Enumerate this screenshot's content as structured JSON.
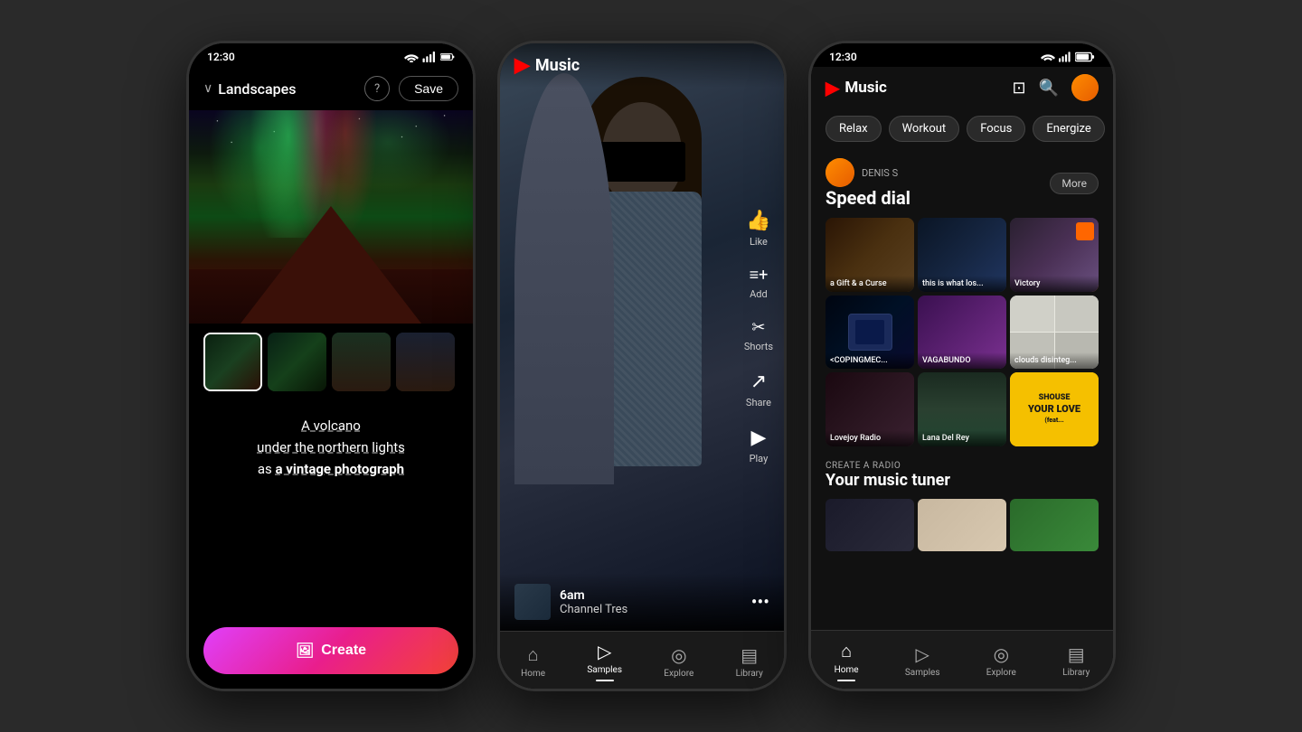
{
  "background": "#2a2a2a",
  "phone1": {
    "status_time": "12:30",
    "header": {
      "title": "Landscapes",
      "help_label": "?",
      "save_label": "Save"
    },
    "thumbnails": [
      {
        "id": "thumb1",
        "label": "aurora volcano",
        "selected": true
      },
      {
        "id": "thumb2",
        "label": "aurora 2",
        "selected": false
      },
      {
        "id": "thumb3",
        "label": "mountain",
        "selected": false
      },
      {
        "id": "thumb4",
        "label": "mountain 2",
        "selected": false
      }
    ],
    "prompt": {
      "line1": "A volcano",
      "line2": "under the northern lights",
      "line3_prefix": "as ",
      "line3_main": "a vintage photograph"
    },
    "create_btn": "Create",
    "create_icon": "🖼"
  },
  "phone2": {
    "status_time": "",
    "music_logo": "Music",
    "side_actions": [
      {
        "icon": "👍",
        "label": "Like"
      },
      {
        "icon": "☰+",
        "label": "Add"
      },
      {
        "icon": "✂",
        "label": "Shorts"
      },
      {
        "icon": "↗",
        "label": "Share"
      },
      {
        "icon": "▶",
        "label": "Play"
      }
    ],
    "song": {
      "time": "6am",
      "name": "Channel Tres"
    },
    "nav_items": [
      {
        "icon": "🏠",
        "label": "Home",
        "active": false
      },
      {
        "icon": "▶",
        "label": "Samples",
        "active": true
      },
      {
        "icon": "🧭",
        "label": "Explore",
        "active": false
      },
      {
        "icon": "📚",
        "label": "Library",
        "active": false
      }
    ]
  },
  "phone3": {
    "status_time": "12:30",
    "music_logo": "Music",
    "mood_tabs": [
      {
        "label": "Relax",
        "active": false
      },
      {
        "label": "Workout",
        "active": false
      },
      {
        "label": "Focus",
        "active": false
      },
      {
        "label": "Energize",
        "active": false
      }
    ],
    "user_section": {
      "username": "DENIS S",
      "section_title": "Speed dial",
      "more_label": "More"
    },
    "speed_dial_cards": [
      {
        "label": "a Gift & a Curse",
        "color_class": "card-gift"
      },
      {
        "label": "this is what los...",
        "color_class": "card-what"
      },
      {
        "label": "Victory",
        "color_class": "card-victory"
      },
      {
        "label": "<COPINGMEC...",
        "color_class": "card-coping"
      },
      {
        "label": "VAGABUNDO",
        "color_class": "card-vagabundo"
      },
      {
        "label": "clouds disinteg...",
        "color_class": "card-clouds"
      },
      {
        "label": "Lovejoy Radio",
        "color_class": "card-lovejoy"
      },
      {
        "label": "Lana Del Rey",
        "color_class": "card-lana"
      },
      {
        "label": "Your Love (feat...",
        "color_class": "card-shouse"
      }
    ],
    "radio_section": {
      "sub_label": "CREATE A RADIO",
      "title": "Your music tuner"
    },
    "nav_items": [
      {
        "icon": "🏠",
        "label": "Home",
        "active": true
      },
      {
        "icon": "▶",
        "label": "Samples",
        "active": false
      },
      {
        "icon": "🧭",
        "label": "Explore",
        "active": false
      },
      {
        "icon": "📚",
        "label": "Library",
        "active": false
      }
    ]
  }
}
